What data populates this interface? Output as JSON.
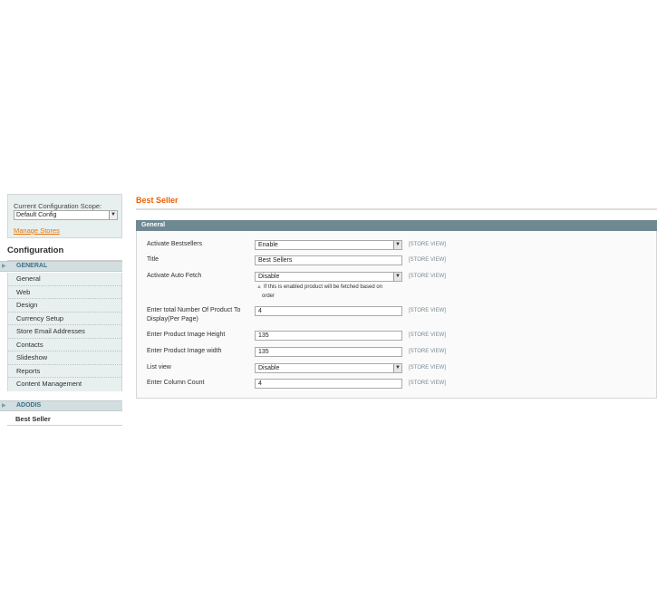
{
  "sidebar": {
    "scope_label": "Current Configuration Scope:",
    "scope_value": "Default Config",
    "manage_stores": "Manage Stores",
    "config_title": "Configuration",
    "general_section": "GENERAL",
    "general_items": [
      "General",
      "Web",
      "Design",
      "Currency Setup",
      "Store Email Addresses",
      "Contacts",
      "Slideshow",
      "Reports",
      "Content Management"
    ],
    "addons_section": "ADODIS",
    "addons_items": [
      "Best Seller"
    ]
  },
  "main": {
    "title": "Best Seller",
    "fieldset_title": "General",
    "scope_tag": "[STORE VIEW]",
    "fields": [
      {
        "label": "Activate Bestsellers",
        "type": "select",
        "value": "Enable"
      },
      {
        "label": "Title",
        "type": "input",
        "value": "Best Sellers"
      },
      {
        "label": "Activate Auto Fetch",
        "type": "select",
        "value": "Disable",
        "hint_line1": "If this is enabled product will be fetched based on",
        "hint_line2": "order"
      },
      {
        "label_line1": "Enter total Number Of Product To",
        "label_line2": "Display(Per Page)",
        "type": "input",
        "value": "4"
      },
      {
        "label": "Enter Product Image Height",
        "type": "input",
        "value": "135"
      },
      {
        "label": "Enter Product Image width",
        "type": "input",
        "value": "135"
      },
      {
        "label": "List view",
        "type": "select",
        "value": "Disable"
      },
      {
        "label": "Enter Column Count",
        "type": "input",
        "value": "4"
      }
    ]
  },
  "colors": {
    "accent": "#eb5e00",
    "section_head": "#6f8992",
    "sidebar_bg": "#e7efef"
  }
}
